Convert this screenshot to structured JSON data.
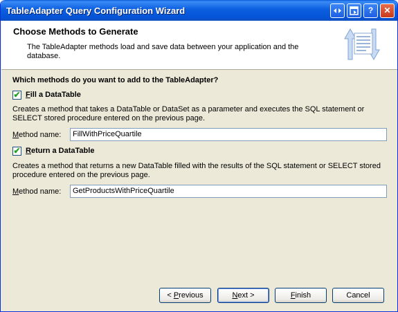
{
  "window": {
    "title": "TableAdapter Query Configuration Wizard",
    "controls": {
      "back": "◂▸",
      "restore": "▣",
      "help": "?",
      "close": "✕"
    }
  },
  "header": {
    "title": "Choose Methods to Generate",
    "description": "The TableAdapter methods load and save data between your application and the database."
  },
  "question": "Which methods do you want to add to the TableAdapter?",
  "fill": {
    "checked": true,
    "label_access": "F",
    "label_rest": "ill a DataTable",
    "description": "Creates a method that takes a DataTable or DataSet as a parameter and executes the SQL statement or SELECT stored procedure entered on the previous page.",
    "method_label_access": "M",
    "method_label_rest": "ethod name:",
    "method_value": "FillWithPriceQuartile"
  },
  "return": {
    "checked": true,
    "label_access": "R",
    "label_rest": "eturn a DataTable",
    "description": "Creates a method that returns a new DataTable filled with the results of the SQL statement or SELECT stored procedure entered on the previous page.",
    "method_label_access": "M",
    "method_label_rest": "ethod name:",
    "method_value": "GetProductsWithPriceQuartile"
  },
  "buttons": {
    "previous_pre": "< ",
    "previous_access": "P",
    "previous_rest": "revious",
    "next_access": "N",
    "next_rest": "ext >",
    "finish_access": "F",
    "finish_rest": "inish",
    "cancel": "Cancel"
  },
  "colors": {
    "titlebar": "#0553d6",
    "dialog_bg": "#ece9d8",
    "header_bg": "#ffffff",
    "check": "#21a121"
  }
}
